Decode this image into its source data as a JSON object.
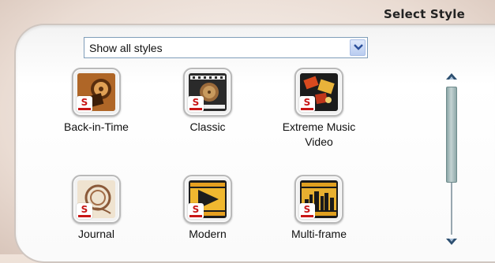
{
  "header": {
    "title": "Select Style"
  },
  "filter": {
    "selected": "Show all styles"
  },
  "styles": [
    {
      "label": "Back-in-Time",
      "icon": "film-reel-icon"
    },
    {
      "label": "Classic",
      "icon": "film-strip-icon"
    },
    {
      "label": "Extreme Music Video",
      "icon": "music-video-icon"
    },
    {
      "label": "Journal",
      "icon": "journal-stamp-icon"
    },
    {
      "label": "Modern",
      "icon": "play-arrow-icon"
    },
    {
      "label": "Multi-frame",
      "icon": "city-skyline-icon"
    }
  ],
  "badge": {
    "letter": "S",
    "color": "#c81616"
  }
}
